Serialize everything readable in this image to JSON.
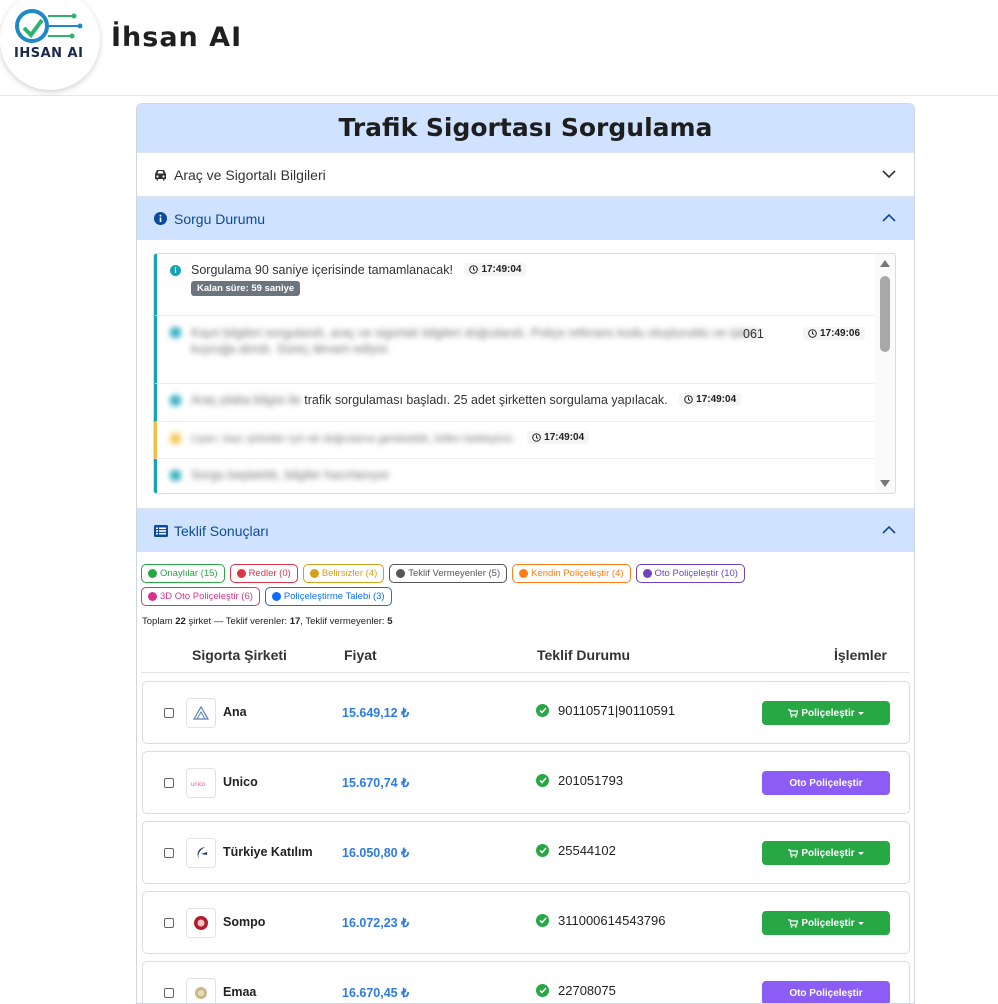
{
  "brand": {
    "logo_text": "IHSAN AI",
    "title": "İhsan AI"
  },
  "card": {
    "title": "Trafik Sigortası Sorgulama"
  },
  "sections": {
    "vehicle": {
      "label": "Araç ve Sigortalı Bilgileri"
    },
    "status": {
      "label": "Sorgu Durumu"
    },
    "offers": {
      "label": "Teklif Sonuçları"
    }
  },
  "logs": [
    {
      "text": "Sorgulama 90 saniye içerisinde tamamlanacak!",
      "time": "17:49:04",
      "badge": "Kalan süre: 59 saniye",
      "level": "info"
    },
    {
      "text_blurred": "Kayıt bilgileri sorgulandı, araç ve sigortalı bilgileri doğrulandı. Poliçe referans kodu oluşturuldu ve işlem kuyruğa alındı. Süreç devam ediyor.",
      "text_visible": "061",
      "time": "17:49:06",
      "level": "info"
    },
    {
      "text_blurred": "Araç plaka bilgisi ile",
      "text_visible": "trafik sorgulaması başladı. 25 adet şirketten sorgulama yapılacak.",
      "time": "17:49:04",
      "level": "info"
    },
    {
      "text_blurred": "Uyarı: bazı şirketler için ek doğrulama gerekebilir, lütfen bekleyiniz.",
      "time": "17:49:04",
      "level": "warn"
    },
    {
      "text_blurred": "Sorgu başlatıldı, bilgiler hazırlanıyor",
      "level": "info"
    }
  ],
  "filters": [
    {
      "label": "Onaylılar (15)",
      "color": "#28a745",
      "icon": "check-circle-icon"
    },
    {
      "label": "Redler (0)",
      "color": "#dc3545",
      "icon": "x-circle-icon"
    },
    {
      "label": "Belirsizler (4)",
      "color": "#d4a017",
      "icon": "question-circle-icon"
    },
    {
      "label": "Teklif Vermeyenler (5)",
      "color": "#555555",
      "icon": "minus-circle-icon"
    },
    {
      "label": "Kendin Poliçeleştir (4)",
      "color": "#fd7e14",
      "icon": "user-icon"
    },
    {
      "label": "Oto Poliçeleştir (10)",
      "color": "#6f42c1",
      "icon": "pencil-icon"
    },
    {
      "label": "3D Oto Poliçeleştir (6)",
      "color": "#d63384",
      "icon": "card-icon"
    },
    {
      "label": "Poliçeleştirme Talebi (3)",
      "color": "#0d6efd",
      "icon": "file-icon"
    }
  ],
  "summary": {
    "prefix": "Toplam",
    "total": "22",
    "mid1": "şirket — Teklif verenler:",
    "givers": "17",
    "mid2": ", Teklif vermeyenler:",
    "nongivers": "5"
  },
  "table": {
    "headers": {
      "company": "Sigorta Şirketi",
      "price": "Fiyat",
      "status": "Teklif Durumu",
      "actions": "İşlemler"
    },
    "rows": [
      {
        "company": "Ana",
        "price": "15.649,12 ₺",
        "status": "90110571|90110591",
        "action": "Poliçeleştir",
        "action_type": "green",
        "logo": "ana-logo-icon"
      },
      {
        "company": "Unico",
        "price": "15.670,74 ₺",
        "status": "201051793",
        "action": "Oto Poliçeleştir",
        "action_type": "purple",
        "logo": "unico-logo-icon"
      },
      {
        "company": "Türkiye Katılım",
        "price": "16.050,80 ₺",
        "status": "25544102",
        "action": "Poliçeleştir",
        "action_type": "green",
        "logo": "turkiye-katilim-logo-icon"
      },
      {
        "company": "Sompo",
        "price": "16.072,23 ₺",
        "status": "311000614543796",
        "action": "Poliçeleştir",
        "action_type": "green",
        "logo": "sompo-logo-icon"
      },
      {
        "company": "Emaa",
        "price": "16.670,45 ₺",
        "status": "22708075",
        "action": "Oto Poliçeleştir",
        "action_type": "purple",
        "logo": "emaa-logo-icon"
      }
    ]
  }
}
